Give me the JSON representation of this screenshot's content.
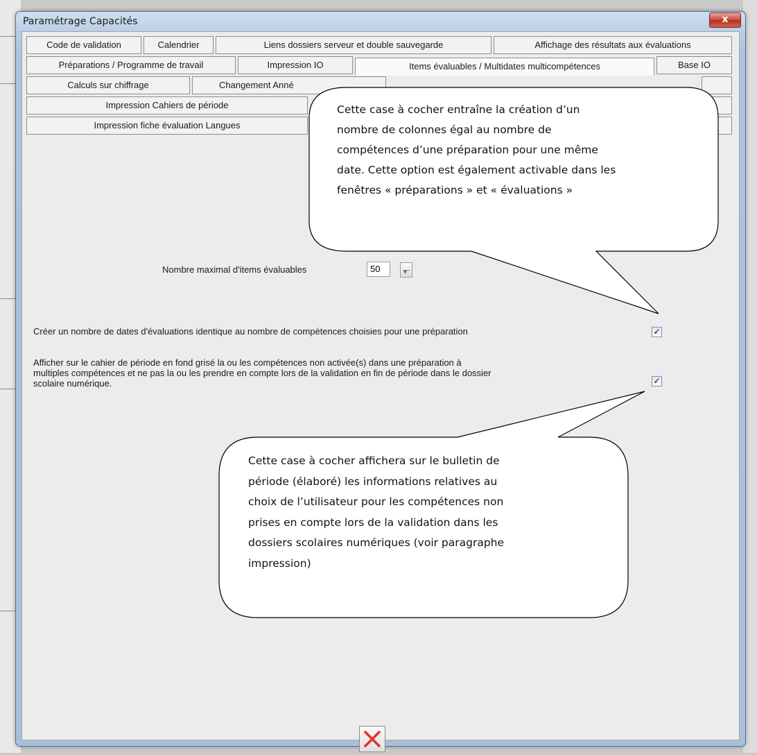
{
  "window": {
    "title": "Paramétrage Capacités",
    "close_glyph": "x"
  },
  "tabs": {
    "row1": [
      "Code de validation",
      "Calendrier",
      "Liens dossiers serveur et double sauvegarde",
      "Affichage des résultats aux évaluations"
    ],
    "row2": [
      "Préparations  / Programme de travail",
      "Impression IO",
      "Items évaluables / Multidates multicompétences",
      "Base IO"
    ],
    "row3": [
      "Calculs sur chiffrage",
      "Changement Anné",
      ""
    ],
    "row4": [
      "Impression Cahiers de période",
      ""
    ],
    "row5": [
      "Impression fiche évaluation Langues",
      ""
    ]
  },
  "form": {
    "max_items_label": "Nombre maximal d'items évaluables",
    "max_items_value": "50",
    "option1_label": "Créer un nombre de dates d'évaluations  identique au nombre de compétences choisies pour une préparation",
    "option1_checked": "✓",
    "option2_line1": "Afficher sur le cahier de période en fond grisé la ou les compétences non activée(s) dans une préparation à",
    "option2_line2": "multiples compétences et ne pas la ou les prendre en compte lors de la validation en fin de période dans le dossier",
    "option2_line3": "scolaire numérique.",
    "option2_checked": "✓"
  },
  "callout1": {
    "lines": [
      "Cette case à cocher entraîne la création d’un",
      "nombre de colonnes égal au nombre de",
      "compétences d’une préparation pour une même",
      "date. Cette option est également activable dans les",
      "fenêtres « préparations » et « évaluations »"
    ]
  },
  "callout2": {
    "lines": [
      "Cette case à cocher affichera sur le bulletin de",
      "période (élaboré)  les informations relatives au",
      "choix de l’utilisateur pour les compétences non",
      "prises en compte lors de la validation dans les",
      "dossiers scolaires numériques (voir paragraphe",
      "impression)"
    ]
  },
  "colors": {
    "close_red": "#c9483a",
    "check_blue": "#2a4f8a",
    "quit_x_red": "#e0322a"
  },
  "icons": [
    "close-icon",
    "checkmark-icon",
    "cancel-x-icon",
    "spin-down-icon"
  ]
}
